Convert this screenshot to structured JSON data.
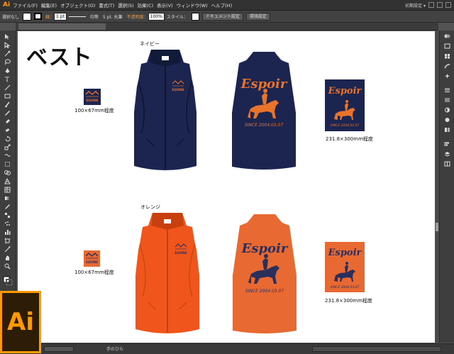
{
  "app": {
    "logo": "Ai",
    "menu": [
      "ファイル(F)",
      "編集(E)",
      "オブジェクト(O)",
      "書式(T)",
      "選択(S)",
      "効果(C)",
      "表示(V)",
      "ウィンドウ(W)",
      "ヘルプ(H)"
    ],
    "workspace": "初期設定 ▾",
    "badge": "Ai"
  },
  "control_bar": {
    "selection": "選択なし",
    "stroke_label": "線：",
    "stroke_weight": "1 pt",
    "profile": "均等",
    "brush": "5 pt. 丸筆",
    "opacity_label": "不透明度：",
    "opacity_value": "100%",
    "style_label": "スタイル：",
    "doc_settings_button": "ドキュメント設定",
    "prefs_button": "環境設定"
  },
  "status": {
    "tool": "手のひら"
  },
  "artboard": {
    "heading": "ベスト",
    "navy": {
      "label": "ネイビー",
      "small_size": "100×67mm程度",
      "large_size": "231.8×300mm程度",
      "logo_text": "EQUINE",
      "brand": "Espoir",
      "since": "SINCE 2004.03.07"
    },
    "orange": {
      "label": "オレンジ",
      "small_size": "100×67mm程度",
      "large_size": "231.8×300mm程度",
      "logo_text": "EQUINE",
      "brand": "Espoir",
      "since": "SINCE 2004.03.07"
    }
  },
  "colors": {
    "navy": "#1c2550",
    "navy_dark": "#121a3a",
    "orange": "#f0561c",
    "orange_back": "#e86a32",
    "accent": "#ff9a00",
    "print_orange": "#e8732a",
    "print_navy": "#2a2f5c"
  }
}
